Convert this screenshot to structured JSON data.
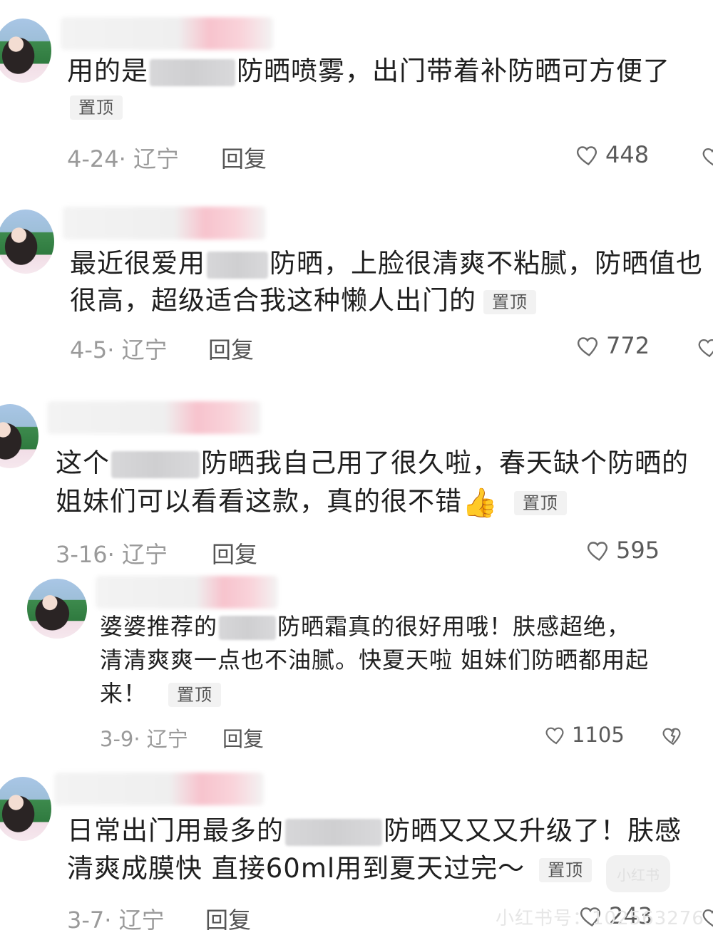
{
  "comments": [
    {
      "text_before": "用的是",
      "text_after": "防晒喷雾，出门带着补防晒可方便了",
      "pin": "置顶",
      "date_loc": "4-24· 辽宁",
      "reply": "回复",
      "likes": "448"
    },
    {
      "line1_before": "最近很爱用",
      "line1_after": "防晒，上脸很清爽不粘腻，防晒值也",
      "line2": "很高，超级适合我这种懒人出门的",
      "pin": "置顶",
      "date_loc": "4-5· 辽宁",
      "reply": "回复",
      "likes": "772"
    },
    {
      "line1_before": "这个",
      "line1_after": "防晒我自己用了很久啦，春天缺个防晒的",
      "line2": "姐妹们可以看看这款，真的很不错",
      "emoji": "👍",
      "pin": "置顶",
      "date_loc": "3-16· 辽宁",
      "reply": "回复",
      "likes": "595"
    },
    {
      "line1_before": "婆婆推荐的",
      "line1_after": "防晒霜真的很好用哦！肤感超绝，",
      "line2": "清清爽爽一点也不油腻。快夏天啦 姐妹们防晒都用起",
      "line3": "来！",
      "pin": "置顶",
      "date_loc": "3-9· 辽宁",
      "reply": "回复",
      "likes": "1105"
    },
    {
      "line1_before": "日常出门用最多的",
      "line1_after": "防晒又又又升级了！肤感",
      "line2": "清爽成膜快 直接60ml用到夏天过完～",
      "pin": "置顶",
      "date_loc": "3-7· 辽宁",
      "reply": "回复",
      "likes": "243"
    }
  ],
  "watermark": {
    "logo": "小红书",
    "text": "小红书号：102563276"
  }
}
